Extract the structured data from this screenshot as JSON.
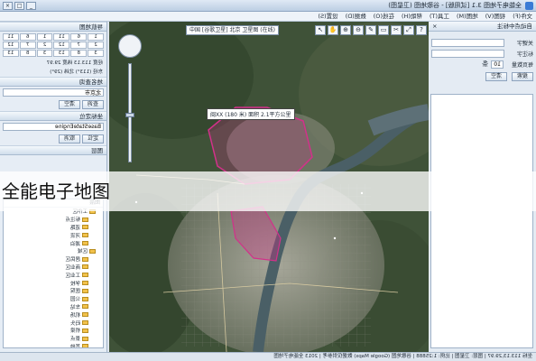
{
  "window": {
    "title": "全能电子地图 3.1 [试用版] - 谷歌地图 (卫星图)",
    "controls": [
      "_",
      "□",
      "×"
    ]
  },
  "menu": [
    "文件(F)",
    "视图(V)",
    "地图(M)",
    "工具(T)",
    "帮助(H)",
    "在线(O)",
    "数据(D)",
    "设置(S)"
  ],
  "left_panel": {
    "title": "自动点中标注",
    "close": "×",
    "fields": [
      {
        "label": "关键字",
        "value": ""
      },
      {
        "label": "标注字",
        "value": ""
      }
    ],
    "count_label": "每页数量",
    "count_value": "10",
    "count_unit": "条",
    "search_button": "搜索",
    "clear_button": "清空"
  },
  "map": {
    "source": "中国 [谷歌卫星] 北京 卫星图 (在线)",
    "tools": [
      "↖",
      "✋",
      "⊕",
      "⊖",
      "✎",
      "▭",
      "✂",
      "⤢",
      "?"
    ],
    "popup": "闽XX (180 米) 面积 2.1平方公里",
    "colors": {
      "boundary": "#d2318a",
      "river": "#4a5f66"
    }
  },
  "status": "坐标 113.13,29.97 | 图层: 卫星图 | 比例: 1:25888 | 谷歌地图 (Google Maps) 数据仅供参考 | 2013 全能电子地图",
  "right_panel": {
    "nav_title": "导航地图",
    "nav_cells": [
      "1",
      "6",
      "11",
      "1",
      "6",
      "11",
      "2",
      "7",
      "12",
      "2",
      "7",
      "12",
      "3",
      "8",
      "13",
      "3",
      "8",
      "13"
    ],
    "coord_text": "经度 113.13 纬度 29.97",
    "coord_text2": "东经 (113°) 北纬 (29°)",
    "search_title": "地名查询",
    "search_value": "北京市",
    "search_btn": "查询",
    "clear_btn": "清空",
    "coord_title": "坐标定位",
    "coord_value": "BaseStateEngine",
    "locate_btn": "定位",
    "cancel_btn": "取消",
    "layer_title": "图层",
    "tree_header": "图层",
    "tree": [
      {
        "label": "工作区",
        "indent": 1
      },
      {
        "label": "标注点",
        "indent": 2
      },
      {
        "label": "道路",
        "indent": 2
      },
      {
        "label": "河流",
        "indent": 2
      },
      {
        "label": "湖泊",
        "indent": 2
      },
      {
        "label": "区域",
        "indent": 1
      },
      {
        "label": "居民区",
        "indent": 2
      },
      {
        "label": "商业区",
        "indent": 2
      },
      {
        "label": "工业区",
        "indent": 2
      },
      {
        "label": "学校",
        "indent": 2
      },
      {
        "label": "医院",
        "indent": 2
      },
      {
        "label": "公园",
        "indent": 2
      },
      {
        "label": "车站",
        "indent": 2
      },
      {
        "label": "机场",
        "indent": 2
      },
      {
        "label": "码头",
        "indent": 2
      },
      {
        "label": "桥梁",
        "indent": 2
      },
      {
        "label": "景点",
        "indent": 2
      },
      {
        "label": "其他",
        "indent": 2
      }
    ]
  },
  "overlay_caption": "全能电子地图"
}
